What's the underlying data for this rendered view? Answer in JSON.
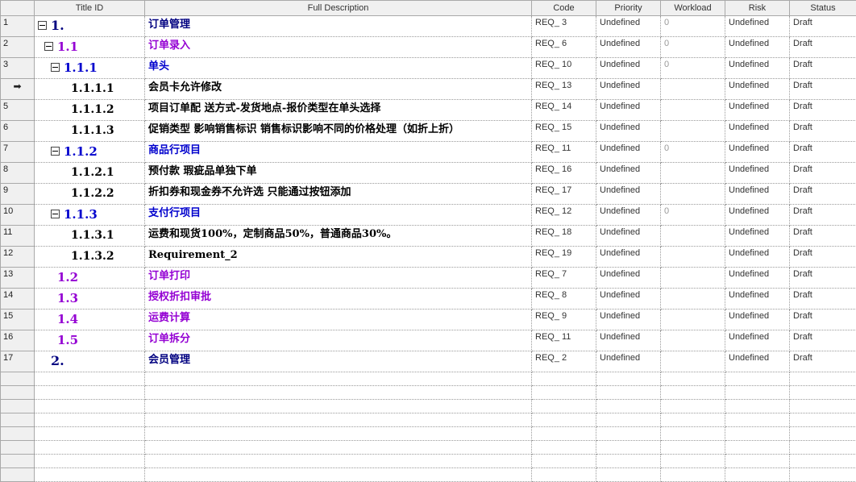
{
  "columns": [
    "",
    "Title ID",
    "Full Description",
    "Code",
    "Priority",
    "Workload",
    "Risk",
    "Status"
  ],
  "rows": [
    {
      "num": "1",
      "level": 1,
      "indent": 4,
      "expander": true,
      "id": "1.",
      "desc": "订单管理",
      "code": "REQ_ 3",
      "priority": "Undefined",
      "workload": "0",
      "risk": "Undefined",
      "status": "Draft"
    },
    {
      "num": "2",
      "level": 2,
      "indent": 12,
      "expander": true,
      "id": "1.1",
      "desc": "订单录入",
      "code": "REQ_ 6",
      "priority": "Undefined",
      "workload": "0",
      "risk": "Undefined",
      "status": "Draft"
    },
    {
      "num": "3",
      "level": 3,
      "indent": 20,
      "expander": true,
      "id": "1.1.1",
      "desc": "单头",
      "code": "REQ_ 10",
      "priority": "Undefined",
      "workload": "0",
      "risk": "Undefined",
      "status": "Draft"
    },
    {
      "num": "",
      "current": true,
      "level": 4,
      "indent": 45,
      "expander": false,
      "id": "1.1.1.1",
      "desc": "会员卡允许修改",
      "code": "REQ_ 13",
      "priority": "Undefined",
      "workload": "",
      "risk": "Undefined",
      "status": "Draft"
    },
    {
      "num": "5",
      "level": 4,
      "indent": 45,
      "expander": false,
      "id": "1.1.1.2",
      "desc": "项目订单配 送方式-发货地点-报价类型在单头选择",
      "code": "REQ_ 14",
      "priority": "Undefined",
      "workload": "",
      "risk": "Undefined",
      "status": "Draft"
    },
    {
      "num": "6",
      "level": 4,
      "indent": 45,
      "expander": false,
      "id": "1.1.1.3",
      "desc": "促销类型 影响销售标识 销售标识影响不同的价格处理（如折上折）",
      "code": "REQ_ 15",
      "priority": "Undefined",
      "workload": "",
      "risk": "Undefined",
      "status": "Draft"
    },
    {
      "num": "7",
      "level": 3,
      "indent": 20,
      "expander": true,
      "id": "1.1.2",
      "desc": "商品行项目",
      "code": "REQ_ 11",
      "priority": "Undefined",
      "workload": "0",
      "risk": "Undefined",
      "status": "Draft"
    },
    {
      "num": "8",
      "level": 4,
      "indent": 45,
      "expander": false,
      "id": "1.1.2.1",
      "desc": "预付款 瑕疵品单独下单",
      "code": "REQ_ 16",
      "priority": "Undefined",
      "workload": "",
      "risk": "Undefined",
      "status": "Draft"
    },
    {
      "num": "9",
      "level": 4,
      "indent": 45,
      "expander": false,
      "id": "1.1.2.2",
      "desc": "折扣券和现金券不允许选 只能通过按钮添加",
      "code": "REQ_ 17",
      "priority": "Undefined",
      "workload": "",
      "risk": "Undefined",
      "status": "Draft"
    },
    {
      "num": "10",
      "level": 3,
      "indent": 20,
      "expander": true,
      "id": "1.1.3",
      "desc": "支付行项目",
      "code": "REQ_ 12",
      "priority": "Undefined",
      "workload": "0",
      "risk": "Undefined",
      "status": "Draft"
    },
    {
      "num": "11",
      "level": 4,
      "indent": 45,
      "expander": false,
      "id": "1.1.3.1",
      "desc": "运费和现货100%，定制商品50%，普通商品30%。",
      "code": "REQ_ 18",
      "priority": "Undefined",
      "workload": "",
      "risk": "Undefined",
      "status": "Draft"
    },
    {
      "num": "12",
      "level": 4,
      "indent": 45,
      "expander": false,
      "id": "1.1.3.2",
      "desc": "Requirement_2",
      "code": "REQ_ 19",
      "priority": "Undefined",
      "workload": "",
      "risk": "Undefined",
      "status": "Draft"
    },
    {
      "num": "13",
      "level": 2,
      "indent": 28,
      "expander": false,
      "id": "1.2",
      "desc": "订单打印",
      "code": "REQ_ 7",
      "priority": "Undefined",
      "workload": "",
      "risk": "Undefined",
      "status": "Draft"
    },
    {
      "num": "14",
      "level": 2,
      "indent": 28,
      "expander": false,
      "id": "1.3",
      "desc": "授权折扣审批",
      "code": "REQ_ 8",
      "priority": "Undefined",
      "workload": "",
      "risk": "Undefined",
      "status": "Draft"
    },
    {
      "num": "15",
      "level": 2,
      "indent": 28,
      "expander": false,
      "id": "1.4",
      "desc": "运费计算",
      "code": "REQ_ 9",
      "priority": "Undefined",
      "workload": "",
      "risk": "Undefined",
      "status": "Draft"
    },
    {
      "num": "16",
      "level": 2,
      "indent": 28,
      "expander": false,
      "id": "1.5",
      "desc": "订单拆分",
      "code": "REQ_ 11",
      "priority": "Undefined",
      "workload": "",
      "risk": "Undefined",
      "status": "Draft"
    },
    {
      "num": "17",
      "level": 1,
      "indent": 20,
      "expander": false,
      "id": "2.",
      "desc": "会员管理",
      "code": "REQ_ 2",
      "priority": "Undefined",
      "workload": "",
      "risk": "Undefined",
      "status": "Draft"
    }
  ],
  "empty_row_count": 8,
  "current_row_marker": "➡",
  "colors": {
    "level1": "#000080",
    "level2": "#9400d3",
    "level3": "#0000cd",
    "level4": "#000000",
    "header_bg": "#f0f0f0",
    "grid_line": "#9a9a9a"
  }
}
